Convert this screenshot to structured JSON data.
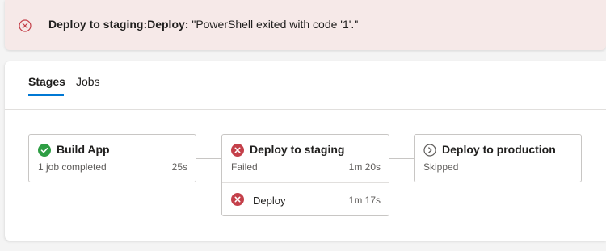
{
  "banner": {
    "bold_text": "Deploy to staging:Deploy:",
    "message": " \"PowerShell exited with code '1'.\""
  },
  "tabs": [
    {
      "label": "Stages"
    },
    {
      "label": "Jobs"
    }
  ],
  "stages": [
    {
      "title": "Build App",
      "status_text": "1 job completed",
      "duration": "25s",
      "status": "succeeded"
    },
    {
      "title": "Deploy to staging",
      "status_text": "Failed",
      "duration": "1m 20s",
      "status": "failed",
      "jobs": [
        {
          "name": "Deploy",
          "duration": "1m 17s",
          "status": "failed"
        }
      ]
    },
    {
      "title": "Deploy to production",
      "status_text": "Skipped",
      "status": "skipped"
    }
  ],
  "colors": {
    "success": "#2e9e44",
    "failure": "#c4404a",
    "accent": "#0078d4"
  }
}
